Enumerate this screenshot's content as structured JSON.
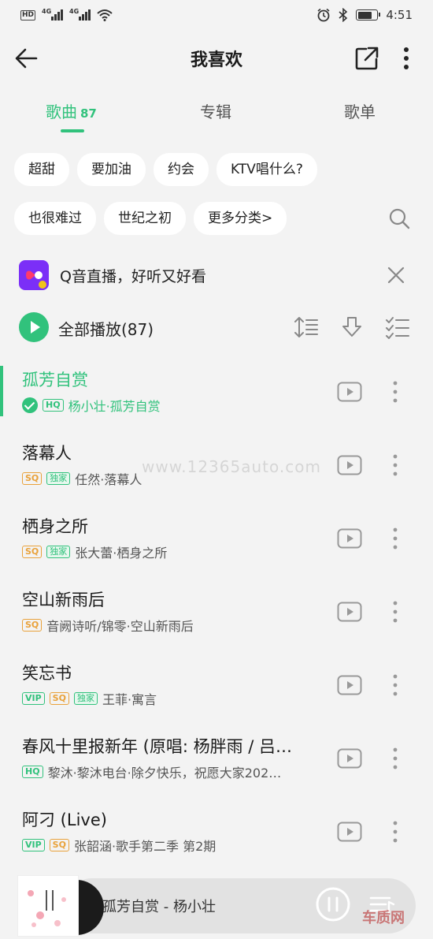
{
  "status_bar": {
    "badge": "HD",
    "net1": "4G",
    "net2": "4G",
    "time": "4:51",
    "battery_level": 0.75
  },
  "header": {
    "title": "我喜欢"
  },
  "tabs": [
    {
      "label": "歌曲",
      "count": "87",
      "active": true
    },
    {
      "label": "专辑"
    },
    {
      "label": "歌单"
    }
  ],
  "chips_row1": [
    "超甜",
    "要加油",
    "约会",
    "KTV唱什么?"
  ],
  "chips_row2": [
    "也很难过",
    "世纪之初",
    "更多分类>"
  ],
  "promo": {
    "text": "Q音直播，好听又好看"
  },
  "play_all": {
    "label": "全部播放(87)"
  },
  "songs": [
    {
      "title": "孤芳自赏",
      "meta": "杨小壮·孤芳自赏",
      "badges": [
        "HQ"
      ],
      "playing": true
    },
    {
      "title": "落幕人",
      "meta": "任然·落幕人",
      "badges": [
        "SQ",
        "独家"
      ]
    },
    {
      "title": "栖身之所",
      "meta": "张大蕾·栖身之所",
      "badges": [
        "SQ",
        "独家"
      ]
    },
    {
      "title": "空山新雨后",
      "meta": "音阙诗听/锦零·空山新雨后",
      "badges": [
        "SQ"
      ]
    },
    {
      "title": "笑忘书",
      "meta": "王菲·寓言",
      "badges": [
        "VIP",
        "SQ",
        "独家"
      ]
    },
    {
      "title": "春风十里报新年 (原唱: 杨胖雨 / 吕…",
      "meta": "黎沐·黎沐电台·除夕快乐，祝愿大家202…",
      "badges": [
        "HQ"
      ]
    },
    {
      "title": "阿刁 (Live)",
      "meta": "张韶涵·歌手第二季 第2期",
      "badges": [
        "VIP",
        "SQ"
      ]
    }
  ],
  "mini_player": {
    "title": "孤芳自赏 - 杨小壮"
  },
  "watermarks": {
    "site": "www.12365auto.com",
    "logo": "车质网"
  },
  "colors": {
    "accent": "#31c27c",
    "sq": "#e9a23b",
    "promo": "#7b2ff7"
  }
}
